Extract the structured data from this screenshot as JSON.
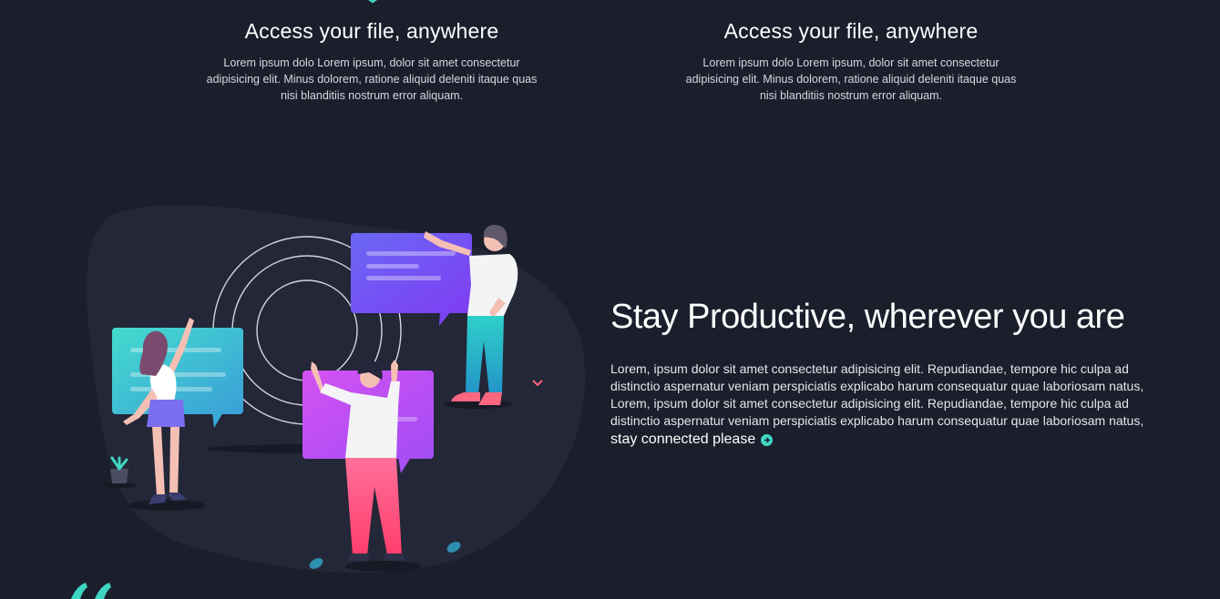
{
  "features": [
    {
      "title": "Access your file, anywhere",
      "text": "Lorem ipsum dolo Lorem ipsum, dolor sit amet consectetur adipisicing elit. Minus dolorem, ratione aliquid deleniti itaque quas nisi blanditiis nostrum error aliquam."
    },
    {
      "title": "Access your file, anywhere",
      "text": "Lorem ipsum dolo Lorem ipsum, dolor sit amet consectetur adipisicing elit. Minus dolorem, ratione aliquid deleniti itaque quas nisi blanditiis nostrum error aliquam."
    }
  ],
  "productive": {
    "heading": "Stay Productive, wherever you are",
    "paragraph_1": "Lorem, ipsum dolor sit amet consectetur adipisicing elit. Repudiandae, tempore hic culpa ad distinctio aspernatur veniam perspiciatis explicabo harum consequatur quae laboriosam natus,",
    "paragraph_2": "Lorem, ipsum dolor sit amet consectetur adipisicing elit. Repudiandae, tempore hic culpa ad distinctio aspernatur veniam perspiciatis explicabo harum consequatur quae laboriosam natus,",
    "cta_label": "stay connected please",
    "cta_icon": "arrow-right-circle-icon"
  },
  "colors": {
    "background": "#1b1f2c",
    "accent": "#3fd6c3",
    "blob": "#232737"
  }
}
